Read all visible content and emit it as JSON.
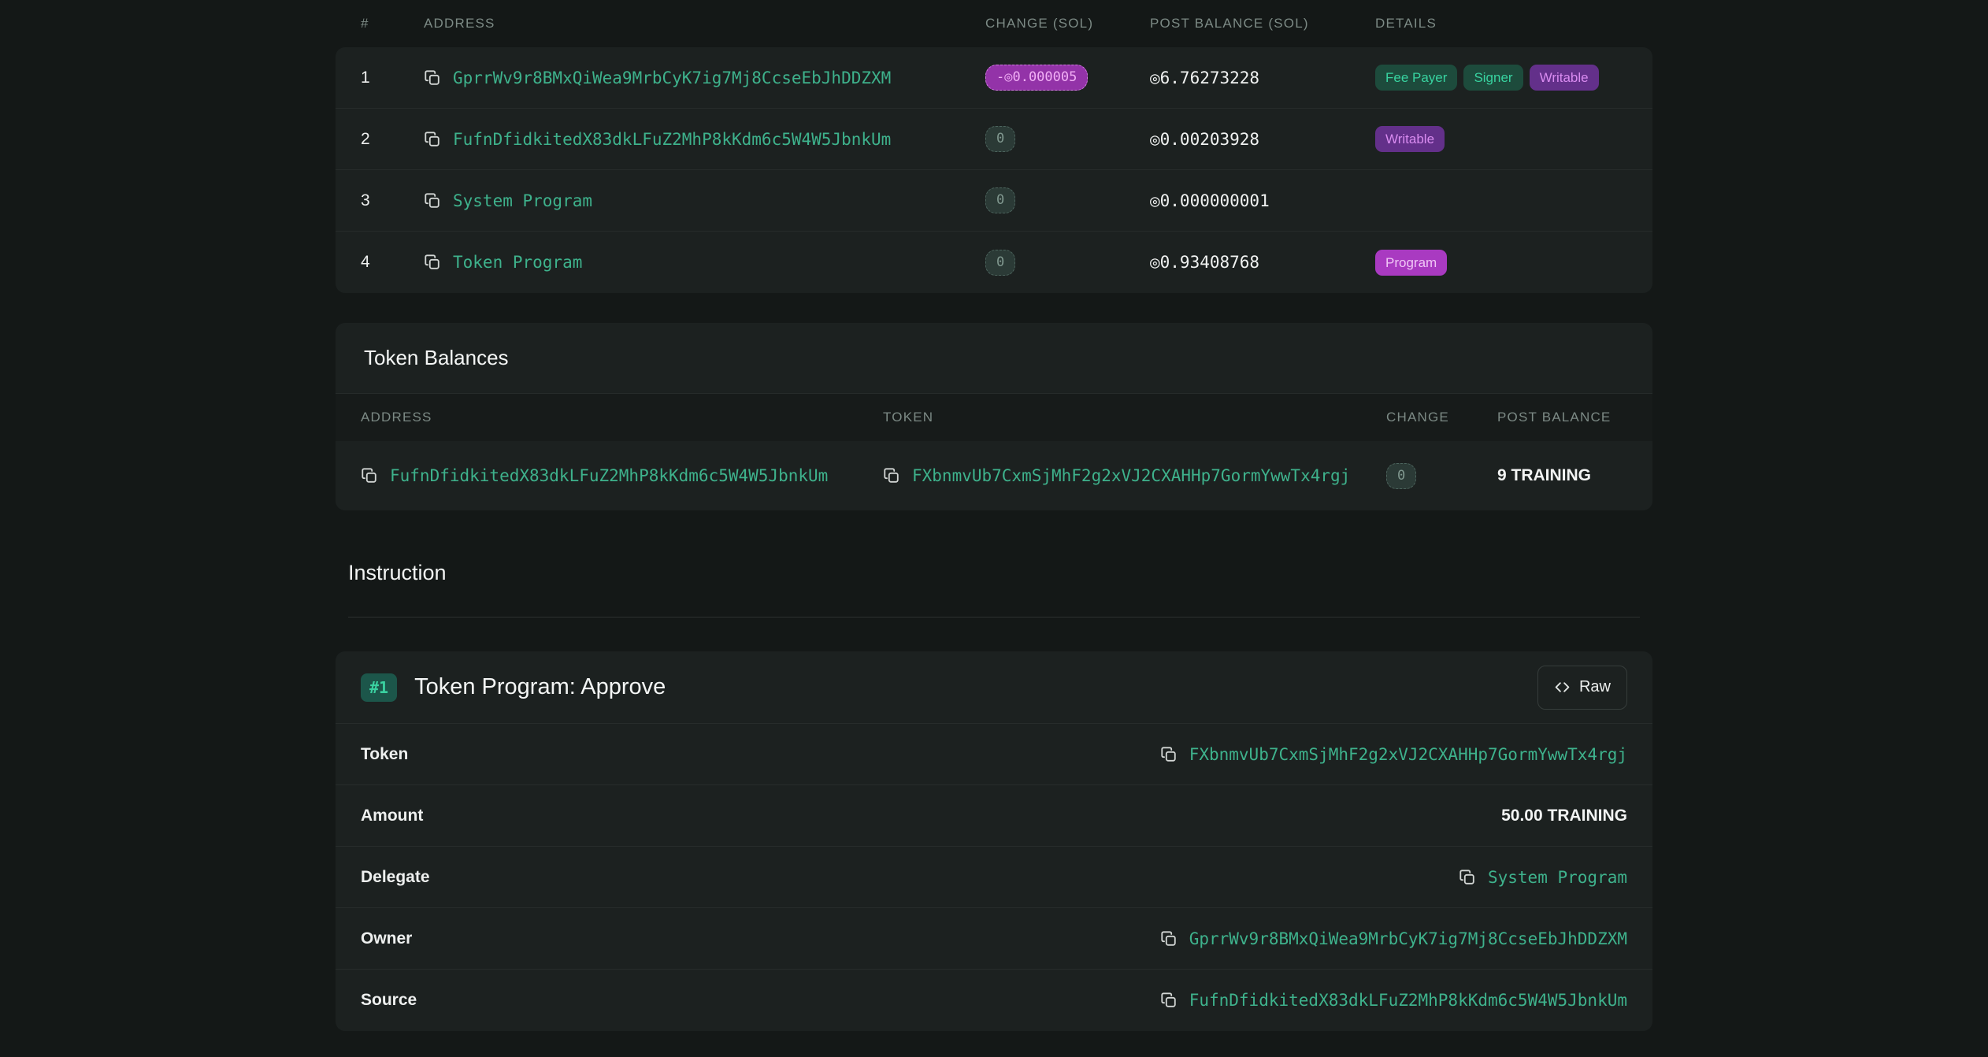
{
  "accounts_table": {
    "columns": [
      "#",
      "ADDRESS",
      "CHANGE (SOL)",
      "POST BALANCE (SOL)",
      "DETAILS"
    ],
    "rows": [
      {
        "index": "1",
        "address": "GprrWv9r8BMxQiWea9MrbCyK7ig7Mj8CcseEbJhDDZXM",
        "change": "-◎0.000005",
        "change_type": "negative",
        "post_balance": "◎6.76273228",
        "badges": [
          {
            "label": "Fee Payer",
            "type": "teal"
          },
          {
            "label": "Signer",
            "type": "teal"
          },
          {
            "label": "Writable",
            "type": "purple"
          }
        ]
      },
      {
        "index": "2",
        "address": "FufnDfidkitedX83dkLFuZ2MhP8kKdm6c5W4W5JbnkUm",
        "change": "0",
        "change_type": "zero",
        "post_balance": "◎0.00203928",
        "badges": [
          {
            "label": "Writable",
            "type": "purple"
          }
        ]
      },
      {
        "index": "3",
        "address": "System Program",
        "change": "0",
        "change_type": "zero",
        "post_balance": "◎0.000000001",
        "badges": []
      },
      {
        "index": "4",
        "address": "Token Program",
        "change": "0",
        "change_type": "zero",
        "post_balance": "◎0.93408768",
        "badges": [
          {
            "label": "Program",
            "type": "magenta"
          }
        ]
      }
    ]
  },
  "token_balances": {
    "title": "Token Balances",
    "columns": [
      "ADDRESS",
      "TOKEN",
      "CHANGE",
      "POST BALANCE"
    ],
    "rows": [
      {
        "address": "FufnDfidkitedX83dkLFuZ2MhP8kKdm6c5W4W5JbnkUm",
        "token": "FXbnmvUb7CxmSjMhF2g2xVJ2CXAHHp7GormYwwTx4rgj",
        "change": "0",
        "post_balance": "9 TRAINING"
      }
    ]
  },
  "instruction": {
    "section_title": "Instruction",
    "index_badge": "#1",
    "title": "Token Program: Approve",
    "raw_button_label": "Raw",
    "rows": [
      {
        "label": "Token",
        "type": "address",
        "value": "FXbnmvUb7CxmSjMhF2g2xVJ2CXAHHp7GormYwwTx4rgj"
      },
      {
        "label": "Amount",
        "type": "text",
        "value": "50.00 TRAINING"
      },
      {
        "label": "Delegate",
        "type": "address",
        "value": "System Program"
      },
      {
        "label": "Owner",
        "type": "address",
        "value": "GprrWv9r8BMxQiWea9MrbCyK7ig7Mj8CcseEbJhDDZXM"
      },
      {
        "label": "Source",
        "type": "address",
        "value": "FufnDfidkitedX83dkLFuZ2MhP8kKdm6c5W4W5JbnkUm"
      }
    ]
  },
  "icons": {
    "copy": "copy-icon",
    "raw": "code-icon"
  },
  "symbols": {
    "sol": "◎"
  },
  "colors": {
    "page_bg": "#141817",
    "card_bg": "#1c2120",
    "accent_teal": "#3eb28c",
    "badge_teal_bg": "#1d4b3c",
    "badge_teal_text": "#38d3a0",
    "badge_purple_bg": "#63308a",
    "badge_purple_text": "#d98bf0",
    "badge_magenta_bg": "#a93ac1",
    "change_negative_bg": "#9333a8",
    "change_negative_text": "#f2b0f6",
    "muted_header_text": "#7c8a85"
  }
}
